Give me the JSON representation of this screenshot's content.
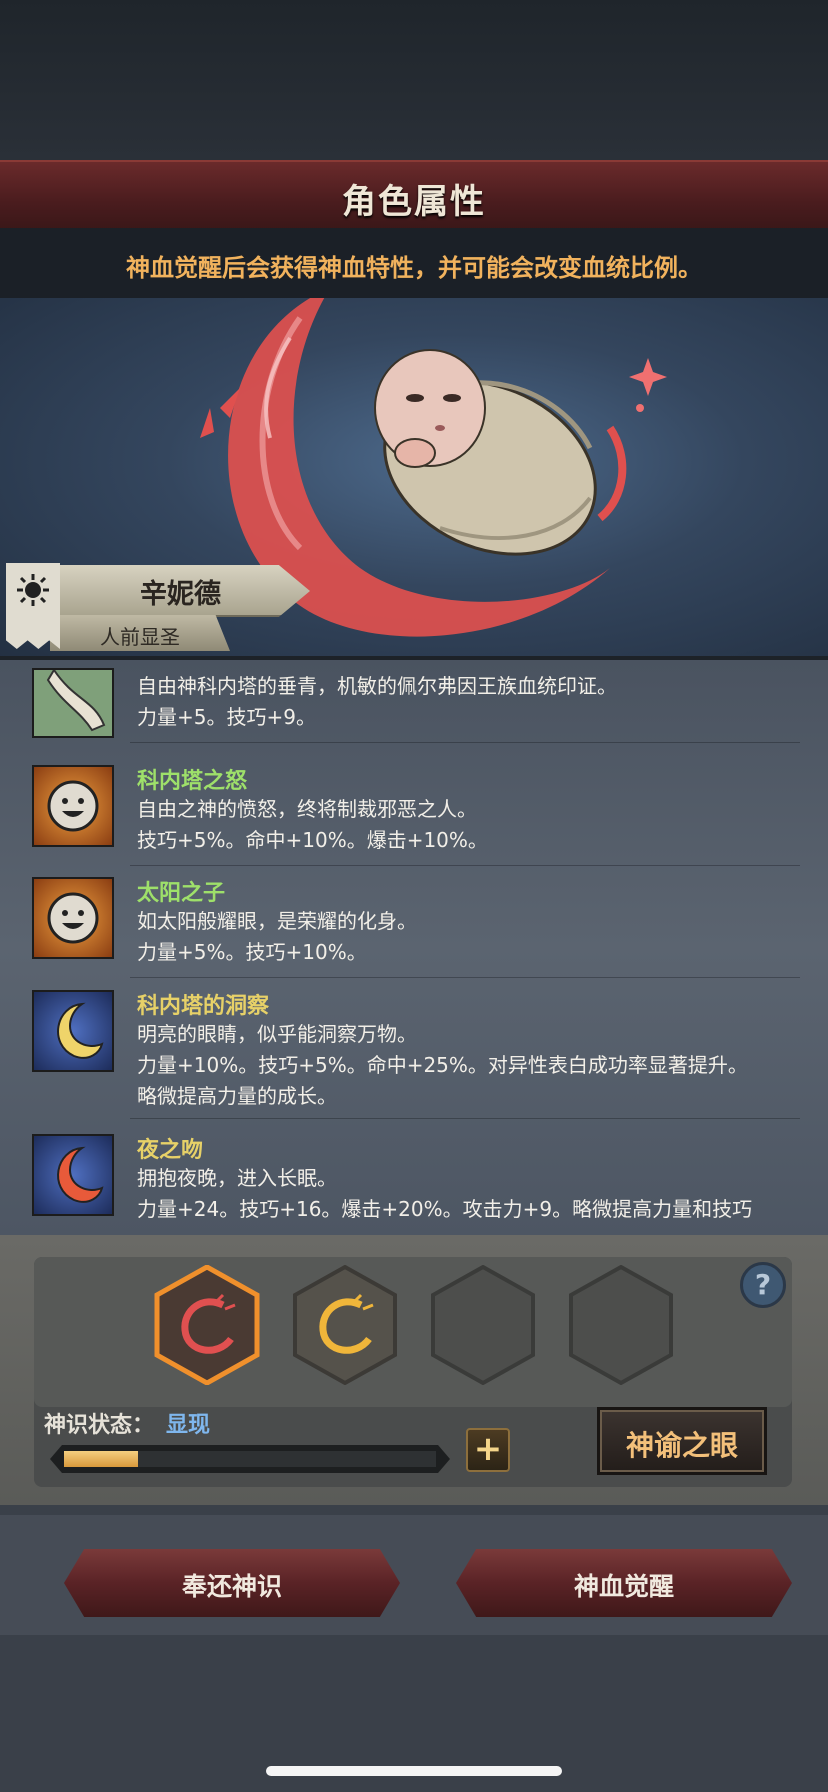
{
  "header": {
    "title": "角色属性",
    "subtitle": "神血觉醒后会获得神血特性，并可能会改变血统比例。"
  },
  "character": {
    "name": "辛妮德",
    "tag": "人前显圣"
  },
  "traits": [
    {
      "name": "",
      "lines": [
        "自由神科内塔的垂青，机敏的佩尔弗因王族血统印证。",
        "力量+5。技巧+9。"
      ],
      "icon": "brush-icon"
    },
    {
      "name": "科内塔之怒",
      "lines": [
        "自由之神的愤怒，终将制裁邪恶之人。",
        "技巧+5%。命中+10%。爆击+10%。"
      ],
      "icon": "sun-face-icon"
    },
    {
      "name": "太阳之子",
      "lines": [
        "如太阳般耀眼，是荣耀的化身。",
        "力量+5%。技巧+10%。"
      ],
      "icon": "sun-face-icon"
    },
    {
      "name": "科内塔的洞察",
      "lines": [
        "明亮的眼睛，似乎能洞察万物。",
        "力量+10%。技巧+5%。命中+25%。对异性表白成功率显著提升。",
        "略微提高力量的成长。"
      ],
      "icon": "crescent-icon"
    },
    {
      "name": "夜之吻",
      "lines": [
        "拥抱夜晚，进入长眠。",
        "力量+24。技巧+16。爆击+20%。攻击力+9。略微提高力量和技巧"
      ],
      "icon": "red-crescent-icon"
    }
  ],
  "panel": {
    "status_label": "神识状态：",
    "status_value": "显现",
    "progress": 0.2,
    "help": "?",
    "plus": "+",
    "oracle_button": "神谕之眼"
  },
  "buttons": {
    "return": "奉还神识",
    "awaken": "神血觉醒"
  },
  "colors": {
    "accent_gold": "#f1b25d",
    "trait_green": "#9ee06a",
    "trait_gold": "#e7d168",
    "status_blue": "#7fb7ee"
  }
}
